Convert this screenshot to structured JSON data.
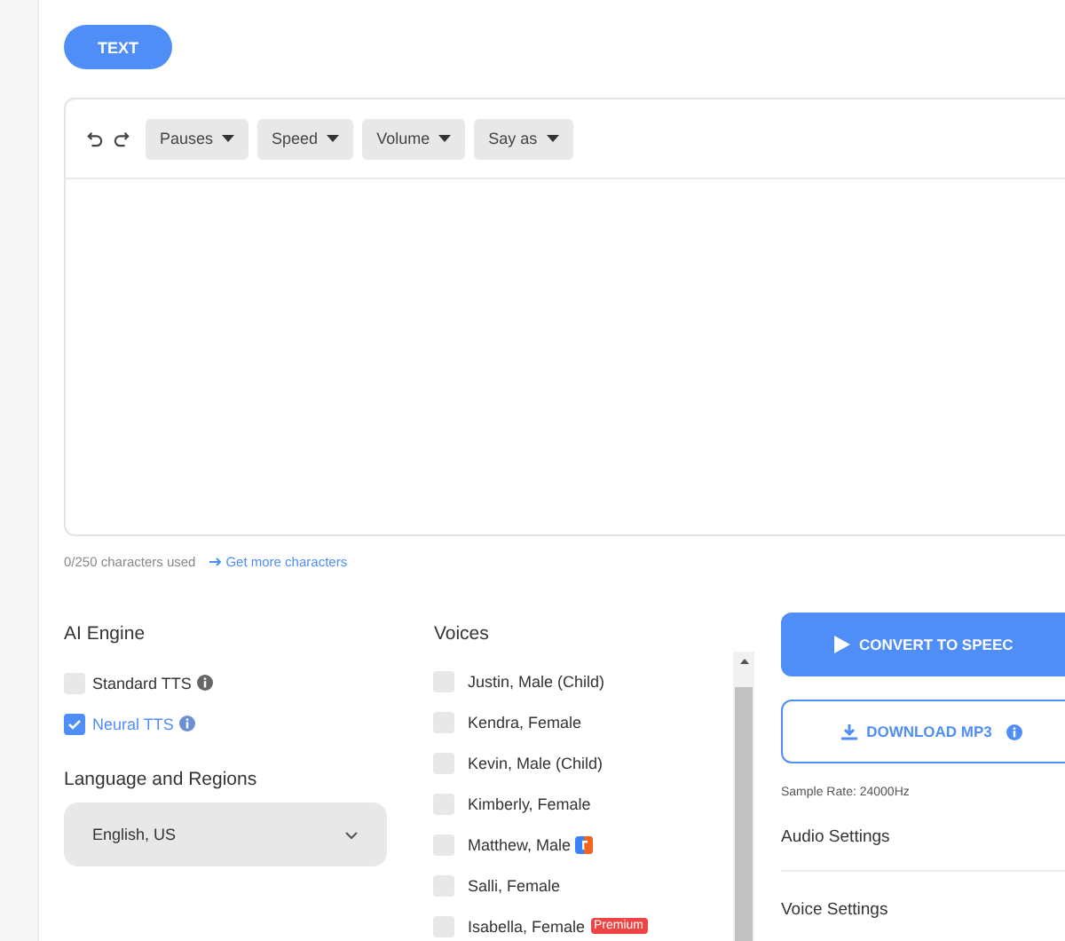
{
  "mode_button": {
    "label": "TEXT",
    "selected": true
  },
  "toolbar": {
    "chips": [
      "Pauses",
      "Speed",
      "Volume",
      "Say as"
    ]
  },
  "editor": {
    "counter": "0/250 characters used",
    "more_link": "Get more characters"
  },
  "ai_engine": {
    "title": "AI Engine",
    "options": [
      {
        "label": "Standard TTS",
        "selected": false
      },
      {
        "label": "Neural TTS",
        "selected": true
      }
    ]
  },
  "language": {
    "title": "Language and Regions",
    "value": "English, US"
  },
  "voices": {
    "title": "Voices",
    "items": [
      {
        "label": "Justin, Male (Child)",
        "checked": false
      },
      {
        "label": "Kendra, Female",
        "checked": false
      },
      {
        "label": "Kevin, Male (Child)",
        "checked": false
      },
      {
        "label": "Kimberly, Female",
        "checked": false
      },
      {
        "label": "Matthew, Male",
        "checked": false,
        "badge": {
          "kind": "icon"
        }
      },
      {
        "label": "Salli, Female",
        "checked": false
      },
      {
        "label": "Isabella, Female",
        "checked": false,
        "badge": {
          "kind": "label",
          "text": "Premium"
        }
      }
    ]
  },
  "actions": {
    "convert": "CONVERT TO SPEEC",
    "download": "DOWNLOAD MP3",
    "sample_rate": "Sample Rate: 24000Hz"
  },
  "settings": [
    "Audio Settings",
    "Voice Settings"
  ]
}
